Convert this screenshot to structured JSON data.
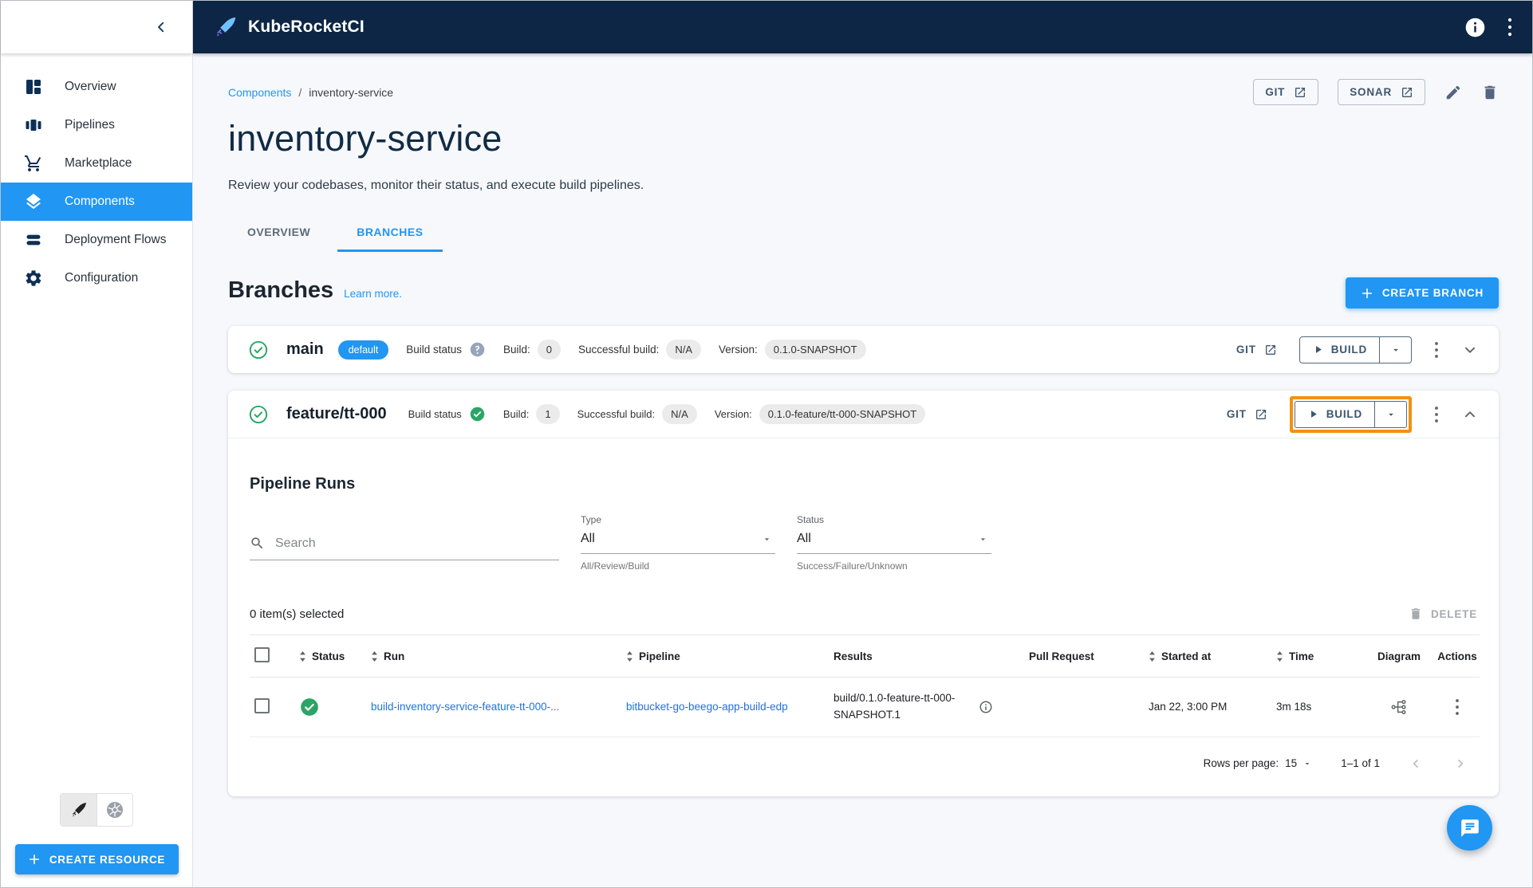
{
  "topbar": {
    "app_name": "KubeRocketCI"
  },
  "sidebar": {
    "items": [
      {
        "label": "Overview"
      },
      {
        "label": "Pipelines"
      },
      {
        "label": "Marketplace"
      },
      {
        "label": "Components"
      },
      {
        "label": "Deployment Flows"
      },
      {
        "label": "Configuration"
      }
    ],
    "create_resource_label": "CREATE RESOURCE"
  },
  "header": {
    "breadcrumb_section": "Components",
    "breadcrumb_sep": "/",
    "breadcrumb_current": "inventory-service",
    "title": "inventory-service",
    "subtitle": "Review your codebases, monitor their status, and execute build pipelines.",
    "git_button": "GIT",
    "sonar_button": "SONAR"
  },
  "tabs": {
    "overview": "OVERVIEW",
    "branches": "BRANCHES"
  },
  "branches_header": {
    "heading": "Branches",
    "learn_more": "Learn more.",
    "create_branch": "CREATE BRANCH"
  },
  "branches": [
    {
      "name": "main",
      "badge": "default",
      "build_status_label": "Build status",
      "build_label": "Build:",
      "build_value": "0",
      "successful_label": "Successful build:",
      "successful_value": "N/A",
      "version_label": "Version:",
      "version_value": "0.1.0-SNAPSHOT",
      "git_label": "GIT",
      "build_button": "BUILD"
    },
    {
      "name": "feature/tt-000",
      "build_status_label": "Build status",
      "build_label": "Build:",
      "build_value": "1",
      "successful_label": "Successful build:",
      "successful_value": "N/A",
      "version_label": "Version:",
      "version_value": "0.1.0-feature/tt-000-SNAPSHOT",
      "git_label": "GIT",
      "build_button": "BUILD"
    }
  ],
  "pipeline_runs": {
    "heading": "Pipeline Runs",
    "search_placeholder": "Search",
    "type_label": "Type",
    "type_value": "All",
    "type_helper": "All/Review/Build",
    "status_label": "Status",
    "status_value": "All",
    "status_helper": "Success/Failure/Unknown",
    "selected_text": "0 item(s) selected",
    "delete_label": "DELETE",
    "columns": {
      "status": "Status",
      "run": "Run",
      "pipeline": "Pipeline",
      "results": "Results",
      "pull_request": "Pull Request",
      "started_at": "Started at",
      "time": "Time",
      "diagram": "Diagram",
      "actions": "Actions"
    },
    "rows": [
      {
        "run": "build-inventory-service-feature-tt-000-...",
        "pipeline": "bitbucket-go-beego-app-build-edp",
        "results": "build/0.1.0-feature-tt-000-SNAPSHOT.1",
        "pull_request": "",
        "started_at": "Jan 22, 3:00 PM",
        "time": "3m 18s"
      }
    ],
    "pagination": {
      "rows_per_page_label": "Rows per page:",
      "rows_per_page_value": "15",
      "range": "1–1 of 1"
    }
  },
  "colors": {
    "topbar_bg": "#0d2646",
    "accent_blue": "#2196f3",
    "link_blue": "#1a73e8",
    "success_green": "#2aa565",
    "highlight_orange": "#f29111",
    "pill_gray": "#ebebeb",
    "page_bg": "#f7f8fc"
  }
}
